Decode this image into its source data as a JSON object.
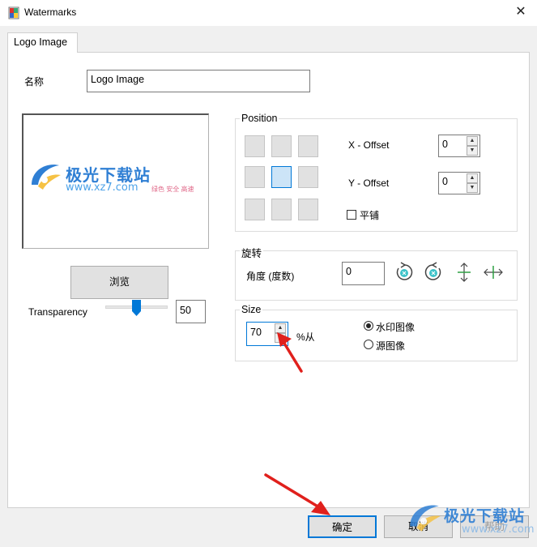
{
  "window": {
    "title": "Watermarks",
    "close_glyph": "✕"
  },
  "tabs": [
    {
      "label": "Logo Image"
    }
  ],
  "name_field": {
    "label": "名称",
    "value": "Logo Image"
  },
  "preview": {
    "brand_text": "极光下载站",
    "brand_url": "www.xz7.com",
    "brand_slogan": "绿色 安全 高速"
  },
  "browse_button": {
    "label": "浏览"
  },
  "transparency": {
    "label": "Transparency",
    "value": "50",
    "level_percent": 50
  },
  "position": {
    "title": "Position",
    "grid_selected": 4,
    "x_offset": {
      "label": "X - Offset",
      "value": "0"
    },
    "y_offset": {
      "label": "Y - Offset",
      "value": "0"
    },
    "tile": {
      "label": "平铺",
      "checked": false
    }
  },
  "rotation": {
    "title": "旋转",
    "angle_label": "角度 (度数)",
    "angle_value": "0",
    "icons": [
      "rotate-ccw-icon",
      "rotate-cw-icon",
      "flip-vertical-icon",
      "flip-horizontal-icon"
    ]
  },
  "size": {
    "title": "Size",
    "value": "70",
    "unit_label": "%从",
    "options": [
      {
        "label": "水印图像",
        "selected": true
      },
      {
        "label": "源图像",
        "selected": false
      }
    ]
  },
  "footer": {
    "ok": "确定",
    "cancel": "取消",
    "help": "帮助"
  },
  "overlay_watermark": {
    "brand_text": "极光下载站",
    "brand_url": "www.xz7.com"
  },
  "colors": {
    "accent": "#0078d7",
    "arrow": "#e0201c",
    "brand": "#2f7fd4"
  }
}
